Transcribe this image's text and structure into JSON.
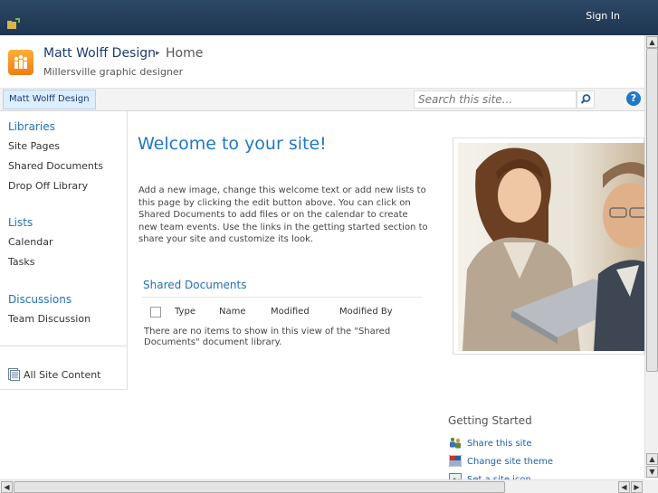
{
  "topbar": {
    "sign_in": "Sign In"
  },
  "header": {
    "site_name": "Matt Wolff Design",
    "breadcrumb_separator": "▸",
    "page_name": "Home",
    "description": "Millersville graphic designer"
  },
  "navbar": {
    "home_tab": "Matt Wolff Design",
    "search_placeholder": "Search this site...",
    "help": "?"
  },
  "quick_launch": {
    "libraries": {
      "heading": "Libraries",
      "items": [
        "Site Pages",
        "Shared Documents",
        "Drop Off Library"
      ]
    },
    "lists": {
      "heading": "Lists",
      "items": [
        "Calendar",
        "Tasks"
      ]
    },
    "discussions": {
      "heading": "Discussions",
      "items": [
        "Team Discussion"
      ]
    },
    "all_site_content": "All Site Content"
  },
  "main": {
    "welcome_title": "Welcome to your site!",
    "welcome_body": "Add a new image, change this welcome text or add new lists to this page by clicking the edit button above. You can click on Shared Documents to add files or on the calendar to create new team events. Use the links in the getting started section to share your site and customize its look.",
    "shared_documents": {
      "title": "Shared Documents",
      "columns": [
        "Type",
        "Name",
        "Modified",
        "Modified By"
      ],
      "empty_message": "There are no items to show in this view of the \"Shared Documents\" document library."
    }
  },
  "getting_started": {
    "title": "Getting Started",
    "items": [
      "Share this site",
      "Change site theme",
      "Set a site icon"
    ]
  },
  "colors": {
    "topbar": "#2b4866",
    "link": "#2470b3",
    "welcome": "#1f78c7"
  }
}
